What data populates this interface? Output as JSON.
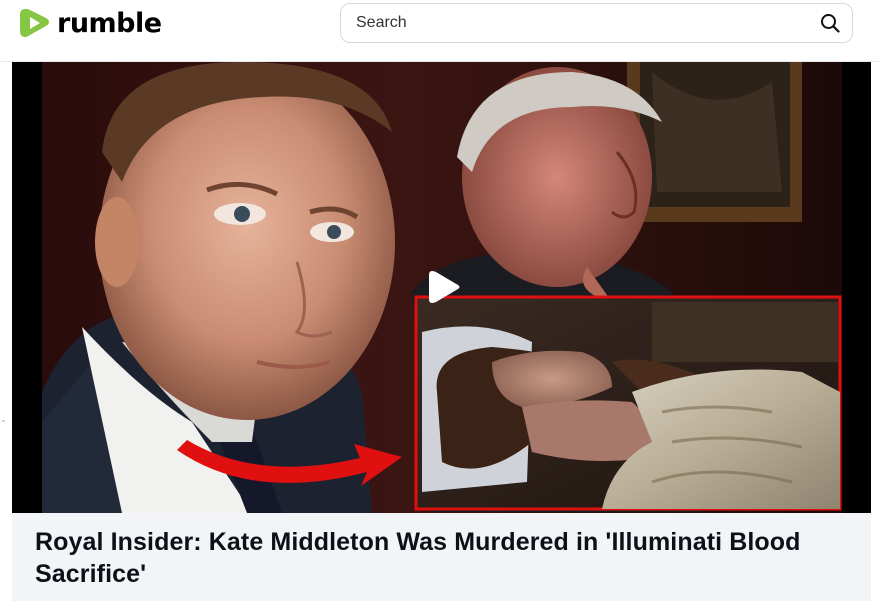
{
  "header": {
    "logo_text": "rumble",
    "logo_icon": "rumble-play-logo",
    "search_placeholder": "Search",
    "search_icon": "search-icon"
  },
  "video": {
    "thumbnail_description_icon": "video-thumbnail",
    "play_icon": "play-icon",
    "title": "Royal Insider: Kate Middleton Was Murdered in 'Illuminati Blood Sacrifice'"
  },
  "colors": {
    "brand_green": "#85c742",
    "highlight_red": "#e01010",
    "title_bg": "#f3f4f7"
  }
}
